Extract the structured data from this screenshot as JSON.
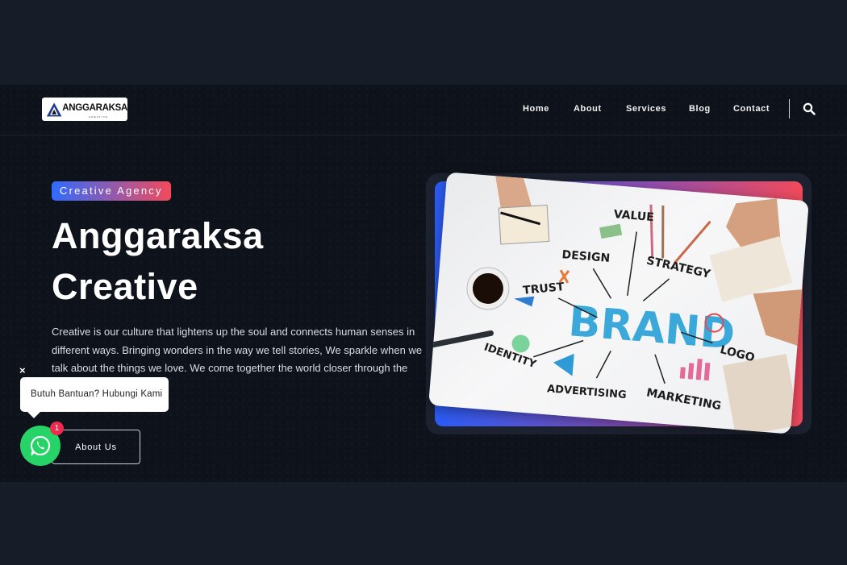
{
  "logo": {
    "text": "ANGGARAKSA",
    "subtext": "CREATIVE"
  },
  "nav": {
    "items": [
      {
        "label": "Home"
      },
      {
        "label": "About"
      },
      {
        "label": "Services"
      },
      {
        "label": "Blog"
      },
      {
        "label": "Contact"
      }
    ],
    "search_icon": "search-icon"
  },
  "hero": {
    "badge": "Creative Agency",
    "title_line1": "Anggaraksa",
    "title_line2": "Creative",
    "description": "Creative is our culture that lightens up the soul and connects human senses in different ways. Bringing wonders in the way we tell stories, We sparkle when we talk about the things we love. We come together the world closer through the things we believe.",
    "button_label": "About Us"
  },
  "illustration": {
    "words": [
      "VALUE",
      "DESIGN",
      "STRATEGY",
      "TRUST",
      "BRAND",
      "LOGO",
      "IDENTITY",
      "ADVERTISING",
      "MARKETING"
    ]
  },
  "whatsapp": {
    "close_label": "×",
    "tooltip": "Butuh Bantuan? Hubungi Kami",
    "badge_count": "1",
    "icon": "whatsapp-icon"
  },
  "colors": {
    "accent_blue": "#2f6bff",
    "accent_red": "#f34a5b",
    "whatsapp_green": "#25d366",
    "badge_red": "#ee2b4f",
    "background": "#0e121a"
  }
}
